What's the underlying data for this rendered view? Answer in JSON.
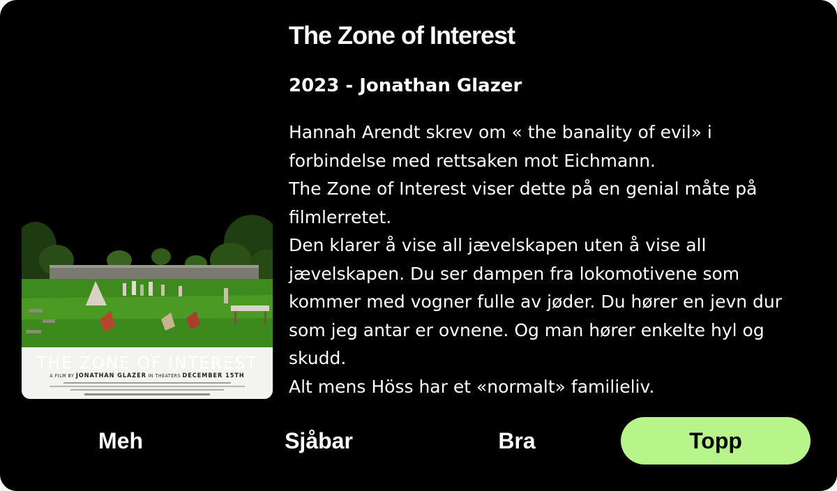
{
  "movie": {
    "title": "The Zone of Interest",
    "year_director": "2023 - Jonathan Glazer",
    "poster": {
      "title": "THE ZONE OF INTEREST",
      "film_by": "A FILM BY",
      "director": "JONATHAN GLAZER",
      "in_theaters": "IN THEATERS",
      "release": "DECEMBER 15TH"
    },
    "review": [
      "Hannah Arendt skrev om « the banality of evil» i forbindelse med rettsaken mot Eichmann.",
      "The Zone of Interest viser dette på en genial måte på filmlerretet.",
      "Den klarer å vise all jævelskapen uten å vise all jævelskapen. Du ser dampen fra lokomotivene som kommer med vogner fulle av jøder. Du hører en jevn dur som jeg antar er ovnene. Og man hører enkelte hyl og skudd.",
      "Alt mens Höss har et «normalt» familieliv."
    ]
  },
  "ratings": [
    {
      "label": "Meh",
      "selected": false
    },
    {
      "label": "Sjåbar",
      "selected": false
    },
    {
      "label": "Bra",
      "selected": false
    },
    {
      "label": "Topp",
      "selected": true
    }
  ],
  "colors": {
    "selected": "#b7f58a",
    "background": "#000000"
  }
}
